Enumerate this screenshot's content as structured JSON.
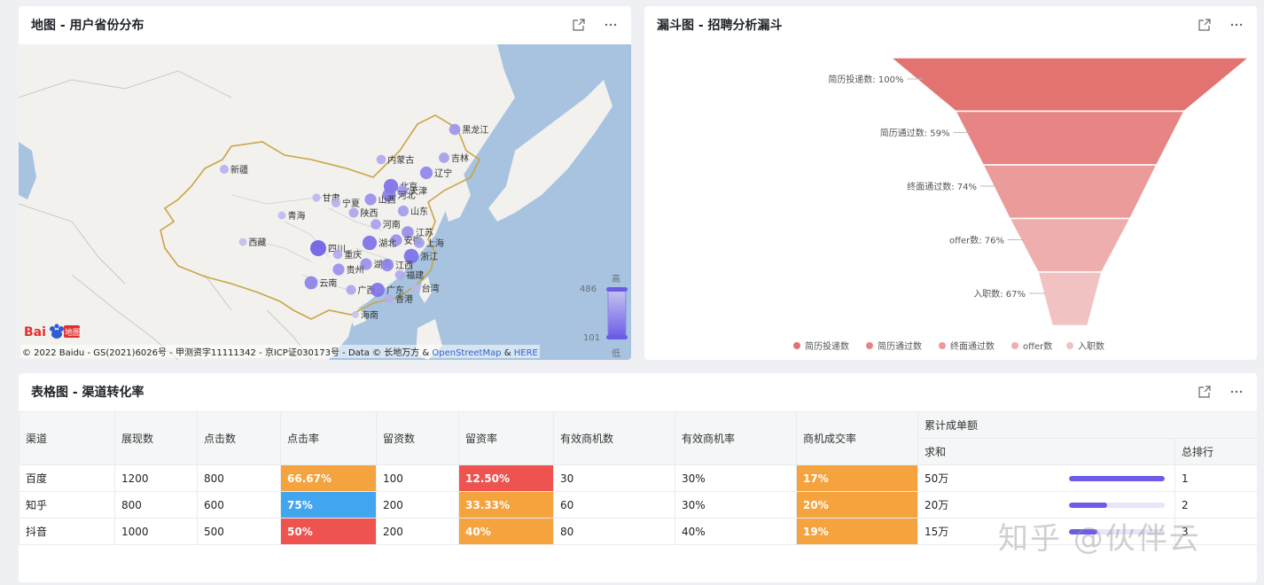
{
  "map": {
    "title": "地图 - 用户省份分布",
    "legend": {
      "high": "高",
      "low": "低",
      "max": "486",
      "min": "101"
    },
    "logo_text": "Bai地图",
    "copyright_prefix": "© 2022 Baidu - GS(2021)6026号 - 甲测资字11111342 - 京ICP证030173号 - Data © 长地万方 &",
    "copyright_link1": "OpenStreetMap",
    "copyright_amp": "&",
    "copyright_link2": "HERE",
    "colors": {
      "low": "#c7c4f0",
      "high": "#6b5ce6",
      "water": "#a7c3df",
      "land": "#f2f1ee",
      "border": "#c9a545"
    },
    "provinces": [
      {
        "name": "黑龙江",
        "value": 280
      },
      {
        "name": "吉林",
        "value": 250
      },
      {
        "name": "辽宁",
        "value": 340
      },
      {
        "name": "内蒙古",
        "value": 200
      },
      {
        "name": "新疆",
        "value": 180
      },
      {
        "name": "北京",
        "value": 420
      },
      {
        "name": "天津",
        "value": 260
      },
      {
        "name": "河北",
        "value": 380
      },
      {
        "name": "甘肃",
        "value": 150
      },
      {
        "name": "宁夏",
        "value": 180
      },
      {
        "name": "山西",
        "value": 300
      },
      {
        "name": "陕西",
        "value": 220
      },
      {
        "name": "山东",
        "value": 260
      },
      {
        "name": "青海",
        "value": 140
      },
      {
        "name": "河南",
        "value": 240
      },
      {
        "name": "江苏",
        "value": 320
      },
      {
        "name": "安徽",
        "value": 300
      },
      {
        "name": "上海",
        "value": 250
      },
      {
        "name": "湖北",
        "value": 420
      },
      {
        "name": "西藏",
        "value": 130
      },
      {
        "name": "四川",
        "value": 486
      },
      {
        "name": "重庆",
        "value": 200
      },
      {
        "name": "浙江",
        "value": 430
      },
      {
        "name": "湖南",
        "value": 300
      },
      {
        "name": "江西",
        "value": 340
      },
      {
        "name": "贵州",
        "value": 300
      },
      {
        "name": "福建",
        "value": 200
      },
      {
        "name": "云南",
        "value": 360
      },
      {
        "name": "广西",
        "value": 220
      },
      {
        "name": "广东",
        "value": 410
      },
      {
        "name": "台湾",
        "value": 150
      },
      {
        "name": "香港",
        "value": 180
      },
      {
        "name": "海南",
        "value": 101
      }
    ]
  },
  "funnel": {
    "title": "漏斗图 - 招聘分析漏斗",
    "stages": [
      {
        "name": "简历投递数",
        "label": "简历投递数: 100%",
        "color": "#e27371"
      },
      {
        "name": "简历通过数",
        "label": "简历通过数: 59%",
        "color": "#e68584"
      },
      {
        "name": "终面通过数",
        "label": "终面通过数: 74%",
        "color": "#ea9b9a"
      },
      {
        "name": "offer数",
        "label": "offer数: 76%",
        "color": "#eeaeae"
      },
      {
        "name": "入职数",
        "label": "入职数: 67%",
        "color": "#f2c2c2"
      }
    ]
  },
  "table": {
    "title": "表格图 - 渠道转化率",
    "group_header": "累计成单额",
    "headers": [
      "渠道",
      "展现数",
      "点击数",
      "点击率",
      "留资数",
      "留资率",
      "有效商机数",
      "有效商机率",
      "商机成交率"
    ],
    "sub_headers": [
      "求和",
      "总排行"
    ],
    "rows": [
      {
        "channel": "百度",
        "impressions": "1200",
        "clicks": "800",
        "ctr": "66.67%",
        "leads": "100",
        "lead_rate": "12.50%",
        "opps": "30",
        "opp_rate": "30%",
        "close_rate": "17%",
        "sum": "50万",
        "sum_ratio": 1.0,
        "rank": "1"
      },
      {
        "channel": "知乎",
        "impressions": "800",
        "clicks": "600",
        "ctr": "75%",
        "leads": "200",
        "lead_rate": "33.33%",
        "opps": "60",
        "opp_rate": "30%",
        "close_rate": "20%",
        "sum": "20万",
        "sum_ratio": 0.4,
        "rank": "2"
      },
      {
        "channel": "抖音",
        "impressions": "1000",
        "clicks": "500",
        "ctr": "50%",
        "leads": "200",
        "lead_rate": "40%",
        "opps": "80",
        "opp_rate": "40%",
        "close_rate": "19%",
        "sum": "15万",
        "sum_ratio": 0.3,
        "rank": "3"
      }
    ]
  },
  "watermark": "知乎 @伙伴云"
}
